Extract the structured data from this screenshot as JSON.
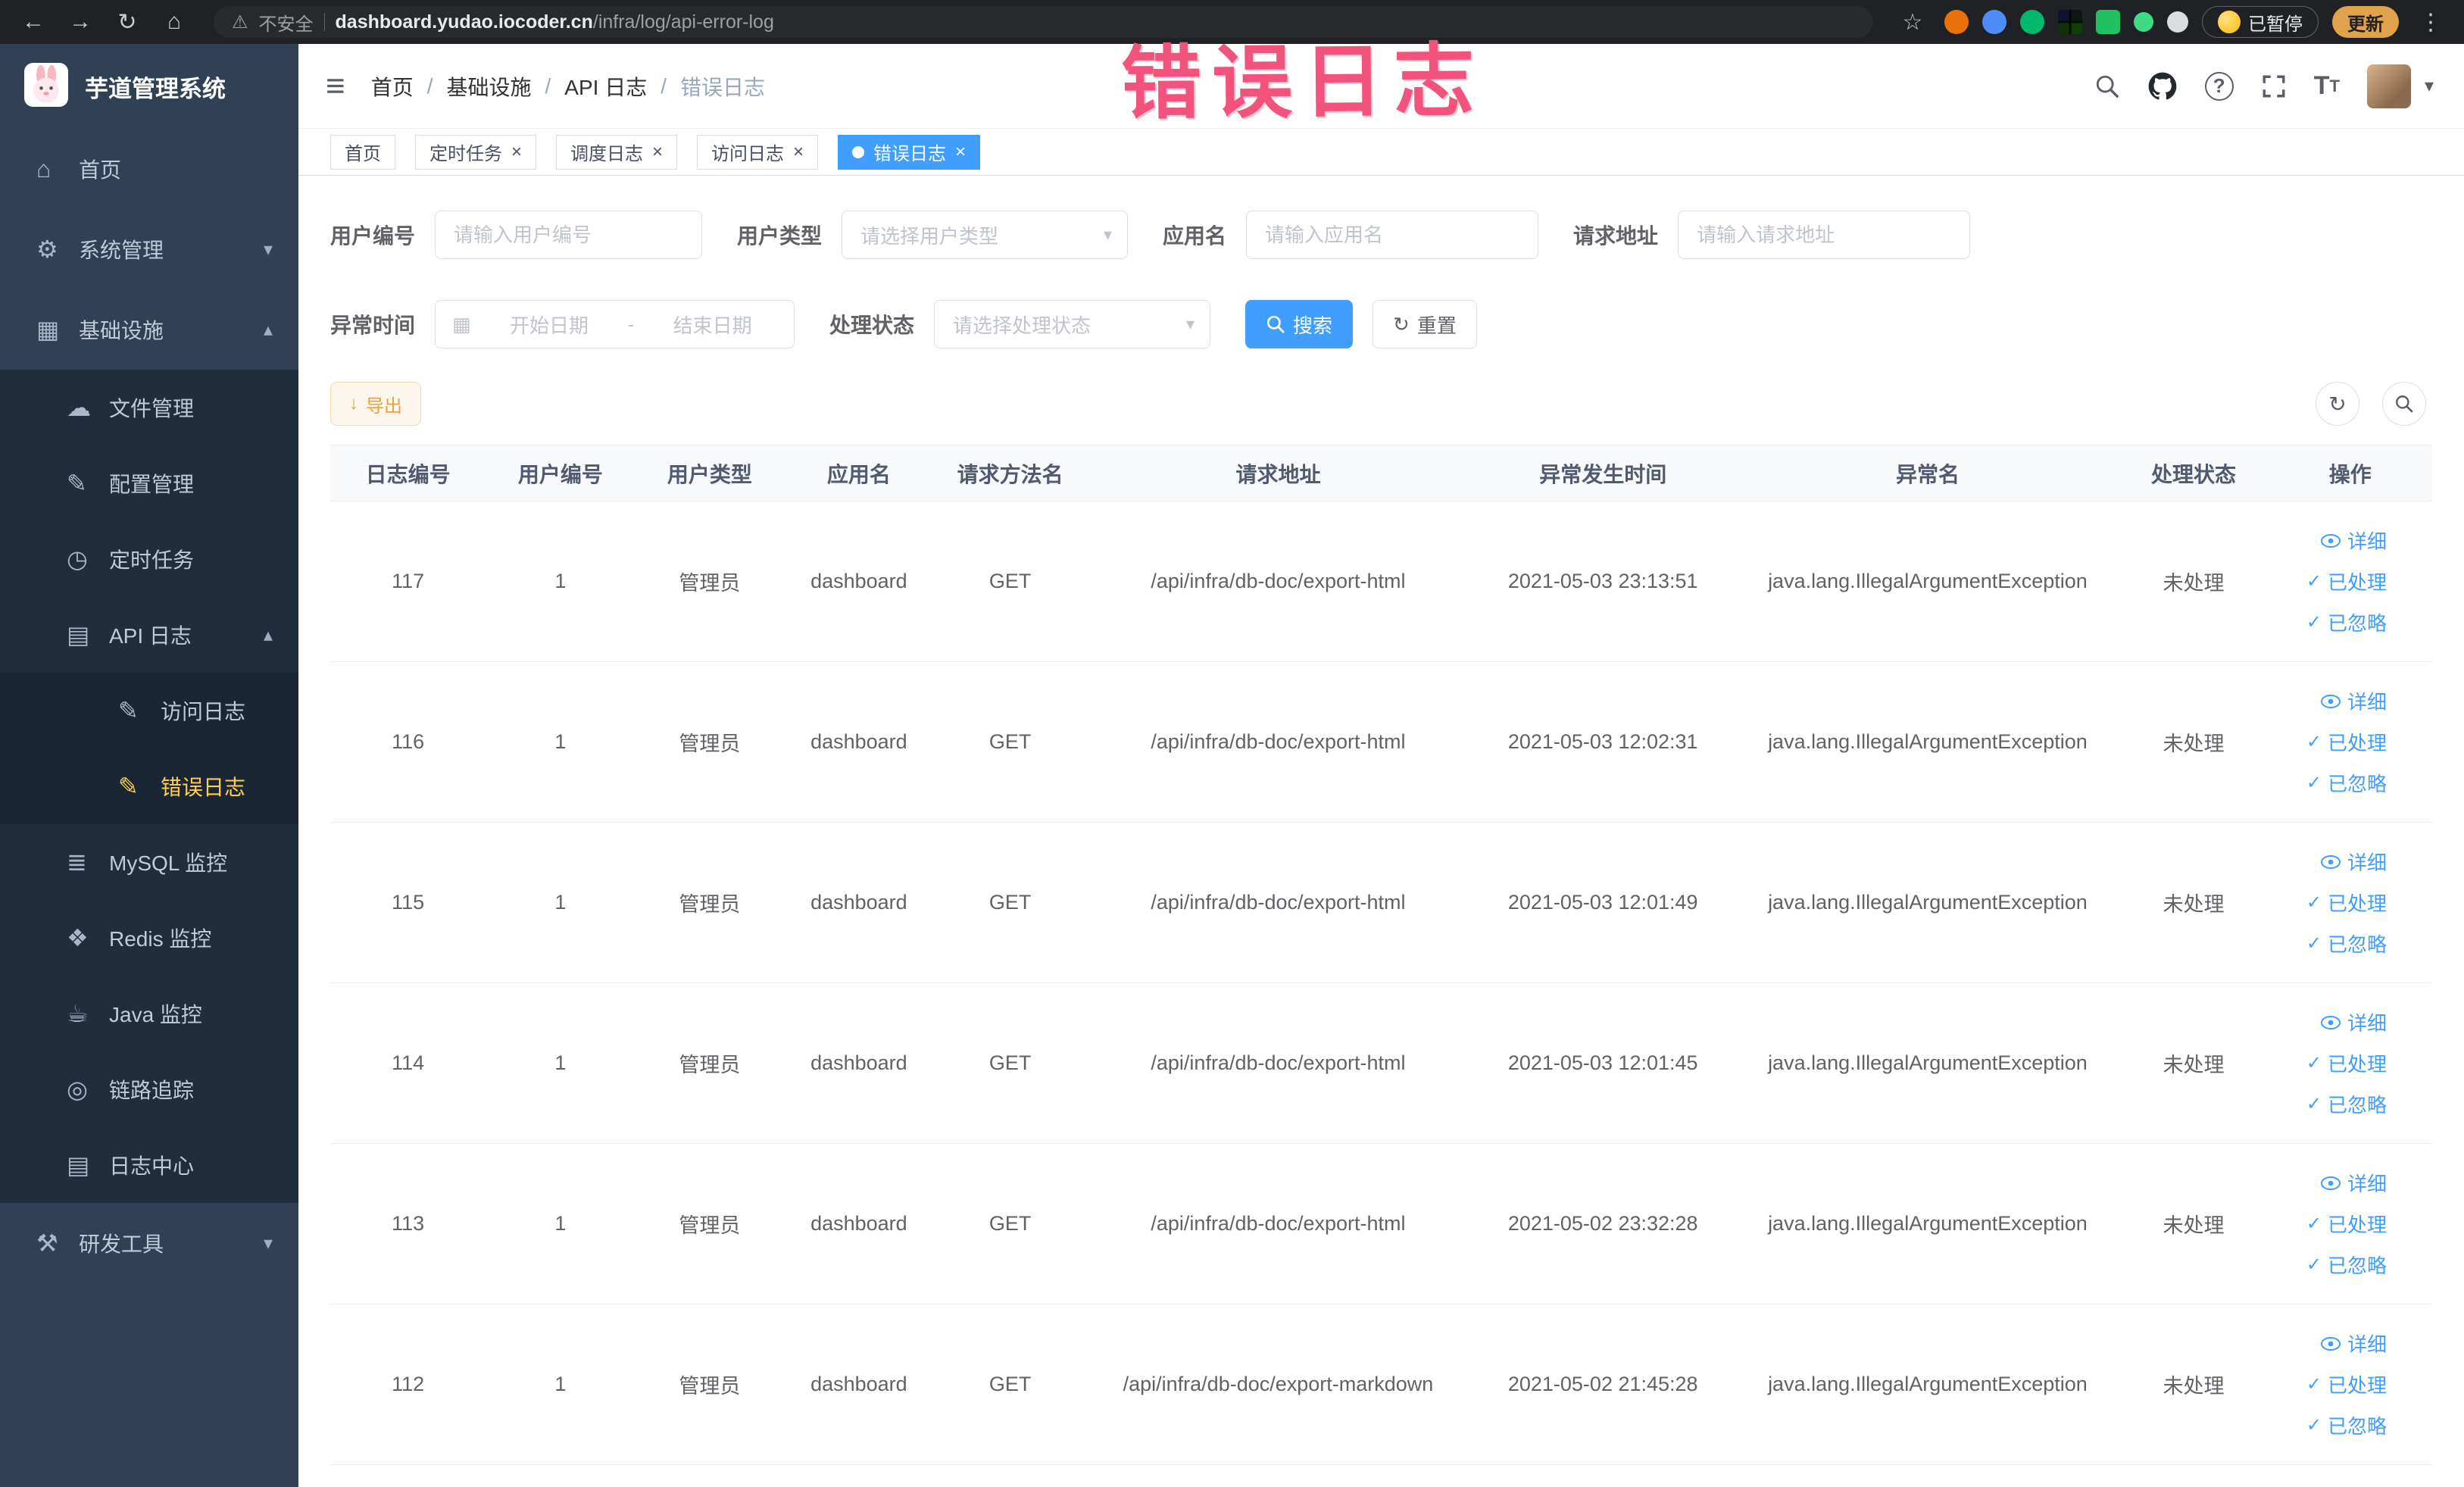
{
  "browser": {
    "security_label": "不安全",
    "url_domain": "dashboard.yudao.iocoder.cn",
    "url_path": "/infra/log/api-error-log",
    "paused_button": "已暂停",
    "update_button": "更新"
  },
  "annotation": {
    "text": "错误日志",
    "color": "#f2537d"
  },
  "icons": {
    "back": "←",
    "forward": "→",
    "reload": "↻",
    "home": "⌂",
    "warning": "⚠",
    "star": "☆",
    "kebab": "⋮",
    "hamburger": "≡",
    "caret_down": "▾",
    "caret_up": "▴",
    "close": "×",
    "calendar": "▦",
    "refresh": "↻",
    "download": "↓",
    "check": "✓",
    "question": "?",
    "font_big": "T",
    "font_small": "T",
    "dash": "-",
    "menu_home": "⌂",
    "menu_gear": "⚙",
    "menu_infra": "▦",
    "menu_cloud": "☁",
    "menu_edit": "✎",
    "menu_clock": "◷",
    "menu_doc": "▤",
    "menu_db": "≣",
    "menu_redis": "❖",
    "menu_java": "☕",
    "menu_trace": "◎",
    "menu_log": "▤",
    "menu_tools": "⚒"
  },
  "sidebar": {
    "logo_title": "芋道管理系统",
    "items": [
      {
        "name": "home",
        "label": "首页",
        "icon": "menu_home",
        "icon_name": "home-icon",
        "level": 1
      },
      {
        "name": "system-management",
        "label": "系统管理",
        "icon": "menu_gear",
        "icon_name": "gear-icon",
        "level": 1,
        "chevron": "down"
      },
      {
        "name": "infrastructure",
        "label": "基础设施",
        "icon": "menu_infra",
        "icon_name": "monitor-icon",
        "level": 1,
        "chevron": "up"
      },
      {
        "name": "file-management",
        "label": "文件管理",
        "icon": "menu_cloud",
        "icon_name": "cloud-icon",
        "level": 2
      },
      {
        "name": "config-management",
        "label": "配置管理",
        "icon": "menu_edit",
        "icon_name": "edit-icon",
        "level": 2
      },
      {
        "name": "scheduled-tasks",
        "label": "定时任务",
        "icon": "menu_clock",
        "icon_name": "clock-icon",
        "level": 2
      },
      {
        "name": "api-logs",
        "label": "API 日志",
        "icon": "menu_doc",
        "icon_name": "document-icon",
        "level": 2,
        "chevron": "up"
      },
      {
        "name": "access-log",
        "label": "访问日志",
        "icon": "menu_edit",
        "icon_name": "edit-doc-icon",
        "level": 3
      },
      {
        "name": "error-log",
        "label": "错误日志",
        "icon": "menu_edit",
        "icon_name": "edit-doc-icon",
        "level": 3,
        "active": true
      },
      {
        "name": "mysql-monitor",
        "label": "MySQL 监控",
        "icon": "menu_db",
        "icon_name": "database-icon",
        "level": 2
      },
      {
        "name": "redis-monitor",
        "label": "Redis 监控",
        "icon": "menu_redis",
        "icon_name": "redis-icon",
        "level": 2
      },
      {
        "name": "java-monitor",
        "label": "Java 监控",
        "icon": "menu_java",
        "icon_name": "coffee-icon",
        "level": 2
      },
      {
        "name": "link-tracing",
        "label": "链路追踪",
        "icon": "menu_trace",
        "icon_name": "trace-icon",
        "level": 2
      },
      {
        "name": "log-center",
        "label": "日志中心",
        "icon": "menu_log",
        "icon_name": "log-icon",
        "level": 2
      },
      {
        "name": "dev-tools",
        "label": "研发工具",
        "icon": "menu_tools",
        "icon_name": "tools-icon",
        "level": 1,
        "chevron": "down"
      }
    ]
  },
  "header": {
    "breadcrumb": [
      "首页",
      "基础设施",
      "API 日志",
      "错误日志"
    ]
  },
  "tabs": [
    {
      "name": "home",
      "label": "首页",
      "closable": false,
      "active": false
    },
    {
      "name": "timed-task",
      "label": "定时任务",
      "closable": true,
      "active": false
    },
    {
      "name": "schedule-log",
      "label": "调度日志",
      "closable": true,
      "active": false
    },
    {
      "name": "access-log",
      "label": "访问日志",
      "closable": true,
      "active": false
    },
    {
      "name": "error-log",
      "label": "错误日志",
      "closable": true,
      "active": true
    }
  ],
  "filters": {
    "user_id": {
      "label": "用户编号",
      "placeholder": "请输入用户编号"
    },
    "user_type": {
      "label": "用户类型",
      "placeholder": "请选择用户类型"
    },
    "app_name": {
      "label": "应用名",
      "placeholder": "请输入应用名"
    },
    "request_url": {
      "label": "请求地址",
      "placeholder": "请输入请求地址"
    },
    "exception_time": {
      "label": "异常时间",
      "start_placeholder": "开始日期",
      "end_placeholder": "结束日期"
    },
    "process_status": {
      "label": "处理状态",
      "placeholder": "请选择处理状态"
    },
    "search_button": "搜索",
    "reset_button": "重置"
  },
  "toolbar": {
    "export_button": "导出"
  },
  "table": {
    "columns": [
      "日志编号",
      "用户编号",
      "用户类型",
      "应用名",
      "请求方法名",
      "请求地址",
      "异常发生时间",
      "异常名",
      "处理状态",
      "操作"
    ],
    "actions": {
      "detail": "详细",
      "processed": "已处理",
      "ignored": "已忽略"
    },
    "rows": [
      {
        "id": "117",
        "user_id": "1",
        "user_type": "管理员",
        "app": "dashboard",
        "method": "GET",
        "url": "/api/infra/db-doc/export-html",
        "time": "2021-05-03 23:13:51",
        "exception": "java.lang.IllegalArgumentException",
        "status": "未处理"
      },
      {
        "id": "116",
        "user_id": "1",
        "user_type": "管理员",
        "app": "dashboard",
        "method": "GET",
        "url": "/api/infra/db-doc/export-html",
        "time": "2021-05-03 12:02:31",
        "exception": "java.lang.IllegalArgumentException",
        "status": "未处理"
      },
      {
        "id": "115",
        "user_id": "1",
        "user_type": "管理员",
        "app": "dashboard",
        "method": "GET",
        "url": "/api/infra/db-doc/export-html",
        "time": "2021-05-03 12:01:49",
        "exception": "java.lang.IllegalArgumentException",
        "status": "未处理"
      },
      {
        "id": "114",
        "user_id": "1",
        "user_type": "管理员",
        "app": "dashboard",
        "method": "GET",
        "url": "/api/infra/db-doc/export-html",
        "time": "2021-05-03 12:01:45",
        "exception": "java.lang.IllegalArgumentException",
        "status": "未处理"
      },
      {
        "id": "113",
        "user_id": "1",
        "user_type": "管理员",
        "app": "dashboard",
        "method": "GET",
        "url": "/api/infra/db-doc/export-html",
        "time": "2021-05-02 23:32:28",
        "exception": "java.lang.IllegalArgumentException",
        "status": "未处理"
      },
      {
        "id": "112",
        "user_id": "1",
        "user_type": "管理员",
        "app": "dashboard",
        "method": "GET",
        "url": "/api/infra/db-doc/export-markdown",
        "time": "2021-05-02 21:45:28",
        "exception": "java.lang.IllegalArgumentException",
        "status": "未处理"
      }
    ]
  }
}
